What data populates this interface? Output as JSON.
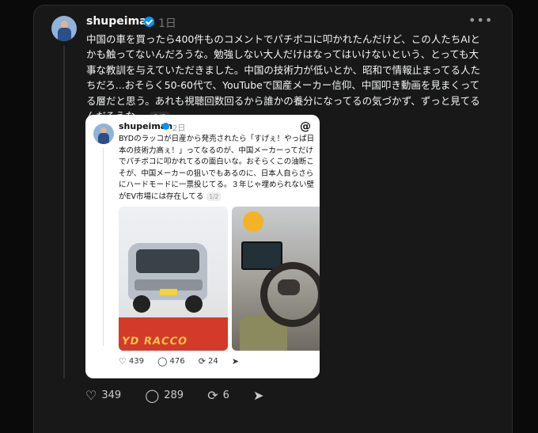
{
  "post": {
    "username": "shupeiman",
    "time": "1日",
    "text": "中国の車を買ったら400件ものコメントでパチボコに叩かれたんだけど、この人たちAIとかも触ってないんだろうな。勉強しない大人だけはなってはいけないという、とっても大事な教訓を与えていただきました。中国の技術力が低いとか、昭和で情報止まってる人たちだろ...おそらく50-60代で、YouTubeで国産メーカー信仰、中国叩き動画を見まくってる層だと思う。あれも視聴回数回るから誰かの養分になってるの気づかず、ずっと見てるんだろうな。",
    "page_indicator": "1/2",
    "actions": {
      "likes": "349",
      "comments": "289",
      "reposts": "6"
    }
  },
  "quoted": {
    "username": "shupeiman",
    "time": "2日",
    "text": "BYDのラッコが日産から発売されたら「すげぇ！やっぱ日本の技術力高ぇ！」ってなるのが、中国メーカーってだけでパチボコに叩かれてるの面白いな。おそらくこの油断こそが、中国メーカーの狙いでもあるのに、日本人自らさらにハードモードに一票投じてる。３年じゃ埋められない壁がEV市場には存在してる",
    "page_indicator": "1/2",
    "photo1_sign": "YD RACCO",
    "actions": {
      "likes": "439",
      "comments": "476",
      "reposts": "24"
    }
  },
  "colors": {
    "background": "#0a0a0a",
    "panel": "#181818",
    "verified": "#0095f6",
    "text": "#f3f5f7",
    "muted": "#777777"
  },
  "icons": [
    "more-icon",
    "verified-icon",
    "threads-logo-icon",
    "heart-icon",
    "comment-icon",
    "repost-icon",
    "share-icon"
  ]
}
